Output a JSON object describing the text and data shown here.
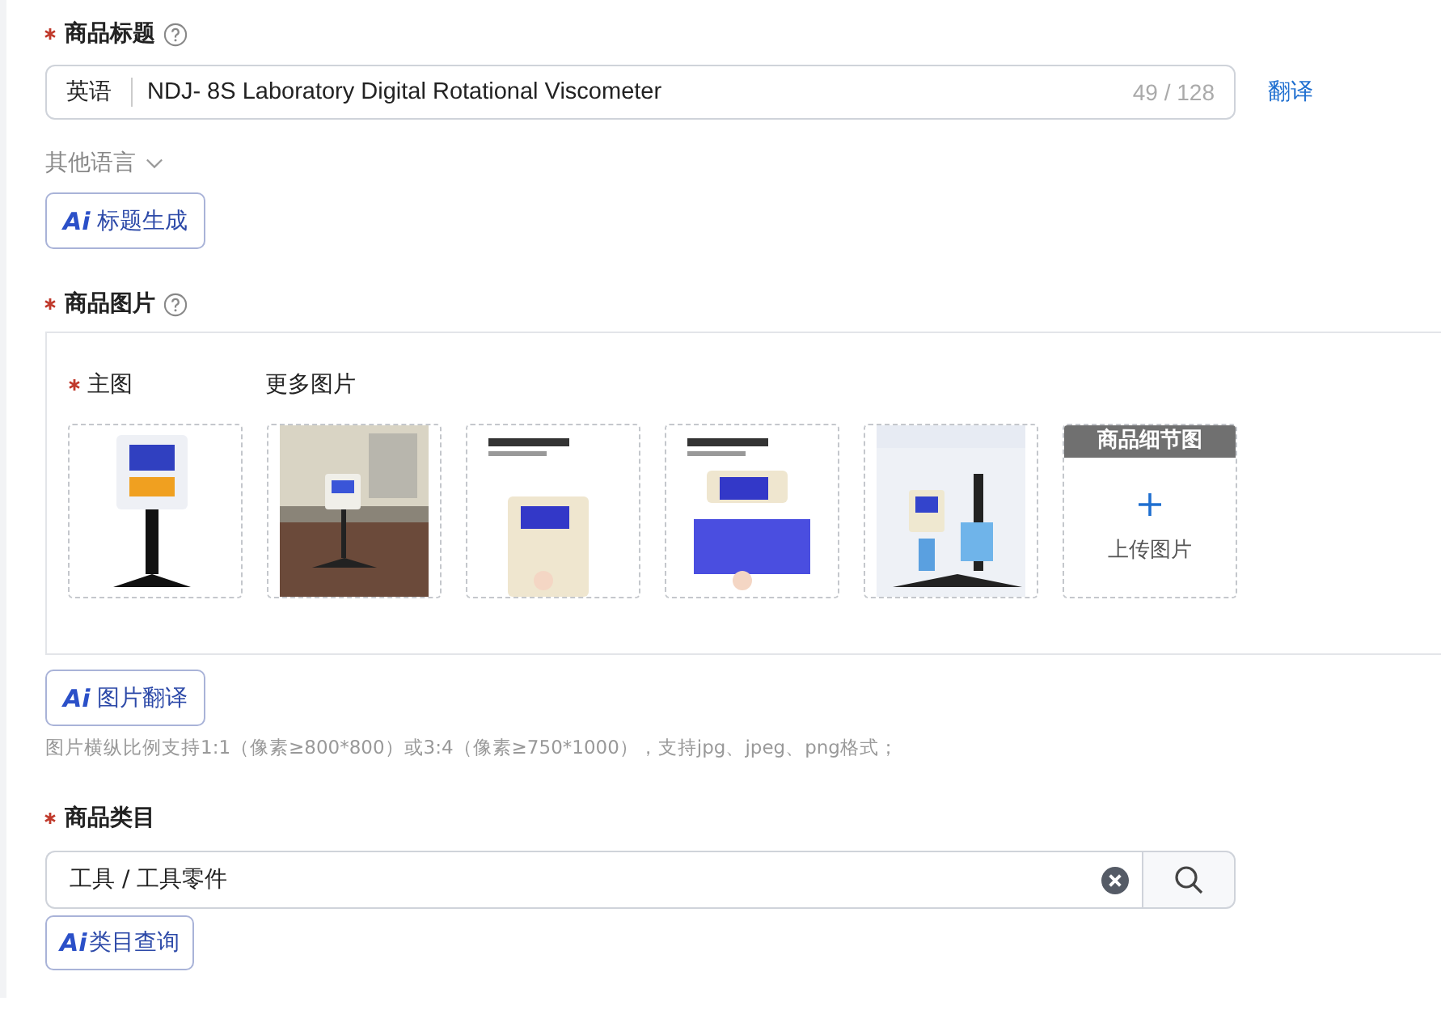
{
  "title_field": {
    "label": "商品标题",
    "required": true,
    "help": true,
    "language": "英语",
    "value": "NDJ- 8S  Laboratory Digital Rotational Viscometer",
    "counter": "49 / 128",
    "translate_link": "翻译",
    "other_languages": "其他语言",
    "ai_button": {
      "badge": "Ai",
      "label": "标题生成"
    }
  },
  "images": {
    "label": "商品图片",
    "required": true,
    "help": true,
    "main_label": "主图",
    "main_required": true,
    "more_label": "更多图片",
    "slots": [
      {
        "kind": "picture"
      },
      {
        "kind": "picture"
      },
      {
        "kind": "picture"
      },
      {
        "kind": "picture"
      },
      {
        "kind": "picture"
      },
      {
        "kind": "upload",
        "header": "商品细节图",
        "label": "上传图片"
      }
    ],
    "ai_button": {
      "badge": "Ai",
      "label": "图片翻译"
    },
    "hint": "图片横纵比例支持1:1（像素≥800*800）或3:4（像素≥750*1000），支持jpg、jpeg、png格式；"
  },
  "category": {
    "label": "商品类目",
    "required": true,
    "value": "工具 / 工具零件",
    "clearable": true,
    "ai_button": {
      "badge": "Ai",
      "label": "类目查询"
    }
  }
}
